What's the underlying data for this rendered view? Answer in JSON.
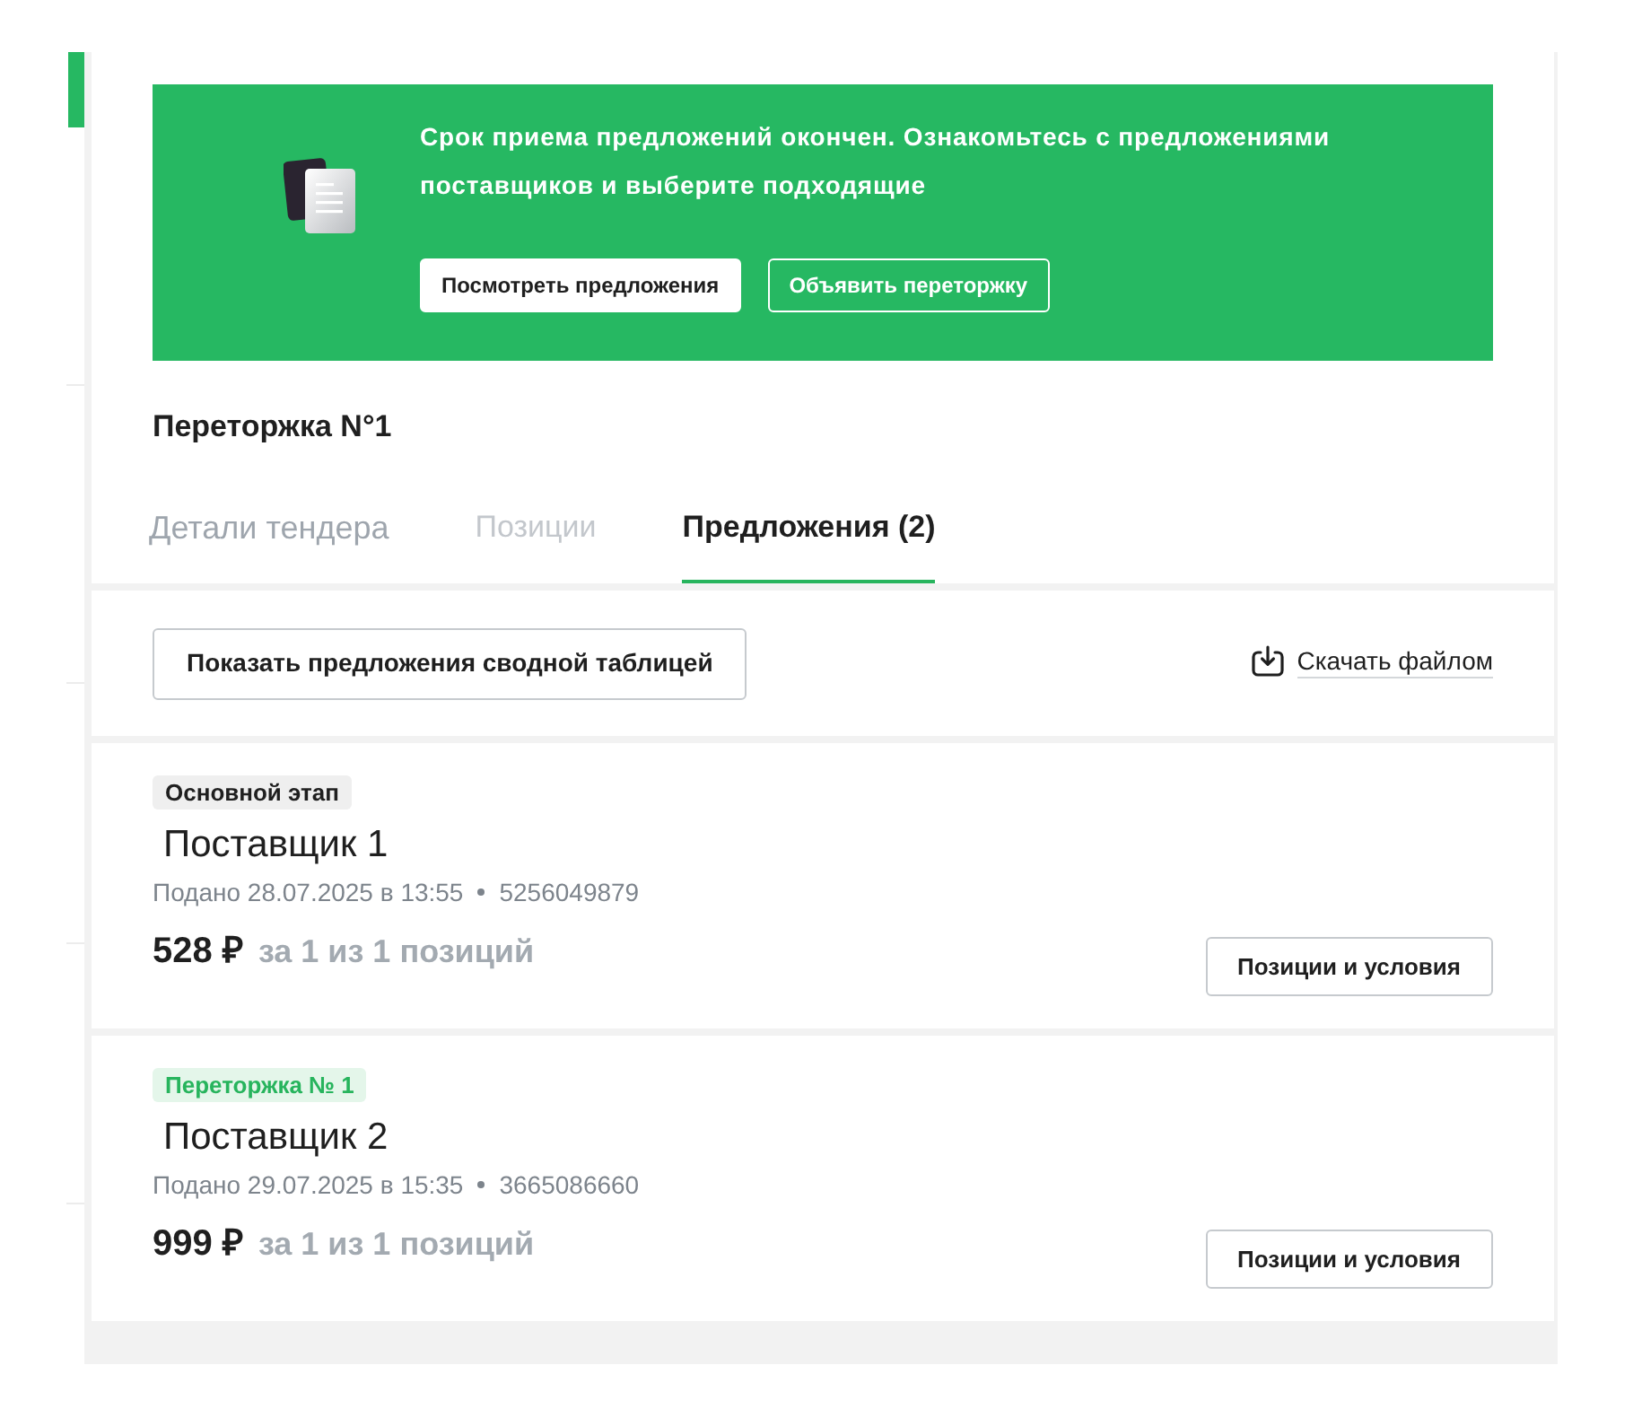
{
  "notice": {
    "text": "Срок приема предложений окончен. Ознакомьтесь с предложениями поставщиков и выберите подходящие",
    "buttons": [
      {
        "label": "Посмотреть предложения",
        "kind": "primary"
      },
      {
        "label": "Объявить переторжку",
        "kind": "outline"
      }
    ]
  },
  "title": "Переторжка N°1",
  "tabs": [
    {
      "label": "Детали тендера",
      "selected": false,
      "disabled": false
    },
    {
      "label": "Позиции",
      "selected": false,
      "disabled": true
    },
    {
      "label": "Предложения (2)",
      "selected": true,
      "disabled": false
    }
  ],
  "toolbar": {
    "summary_button": "Показать предложения сводной таблицей",
    "download_link": "Скачать файлом"
  },
  "offers": [
    {
      "stage": {
        "label": "Основной этап",
        "kind": "main"
      },
      "supplier": "Поставщик 1",
      "submitted": "Подано 28.07.2025 в 13:55",
      "number": "5256049879",
      "price": "528 ₽",
      "coverage": "за 1 из 1 позиций",
      "button": "Позиции и условия"
    },
    {
      "stage": {
        "label": "Переторжка № 1",
        "kind": "rebid"
      },
      "supplier": "Поставщик 2",
      "submitted": "Подано 29.07.2025 в 15:35",
      "number": "3665086660",
      "price": "999 ₽",
      "coverage": "за 1 из 1 позиций",
      "button": "Позиции и условия"
    }
  ]
}
